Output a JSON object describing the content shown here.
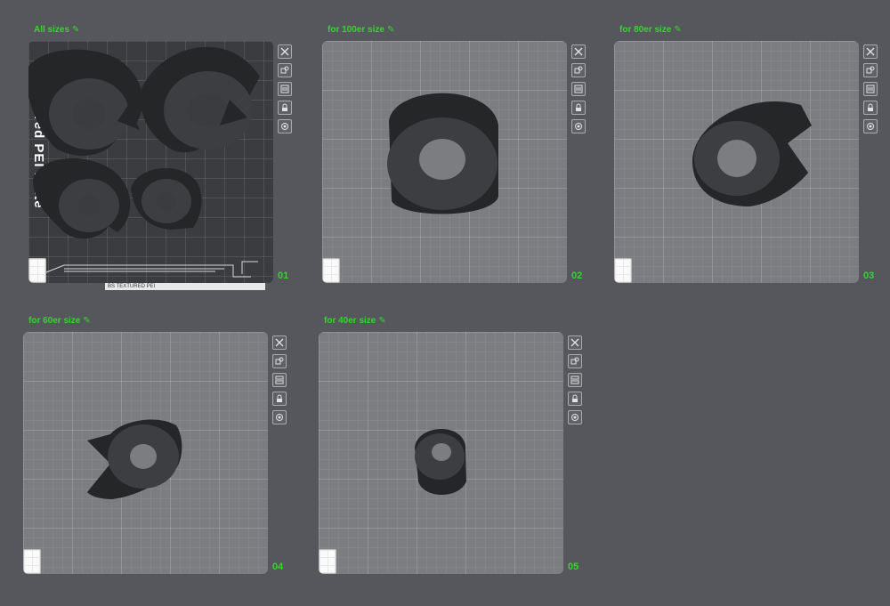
{
  "plates": [
    {
      "id": "01",
      "title": "All sizes",
      "number": "01",
      "plate_text": "Textured PEI Plate",
      "strip_text": "BS  TEXTURED PEI"
    },
    {
      "id": "02",
      "title": "for 100er size",
      "number": "02"
    },
    {
      "id": "03",
      "title": "for 80er size",
      "number": "03"
    },
    {
      "id": "04",
      "title": "for 60er size",
      "number": "04"
    },
    {
      "id": "05",
      "title": "for 40er size",
      "number": "05"
    }
  ],
  "toolbar_icons": [
    "close-icon",
    "auto-arrange-icon",
    "plate-settings-icon",
    "lock-icon",
    "orient-icon"
  ],
  "edit_icon": "pencil-icon",
  "colors": {
    "background": "#55575c",
    "plate": "#7b7d81",
    "title_green": "#34d62c",
    "model_dark": "#252628",
    "model_face": "#3d3e41"
  }
}
